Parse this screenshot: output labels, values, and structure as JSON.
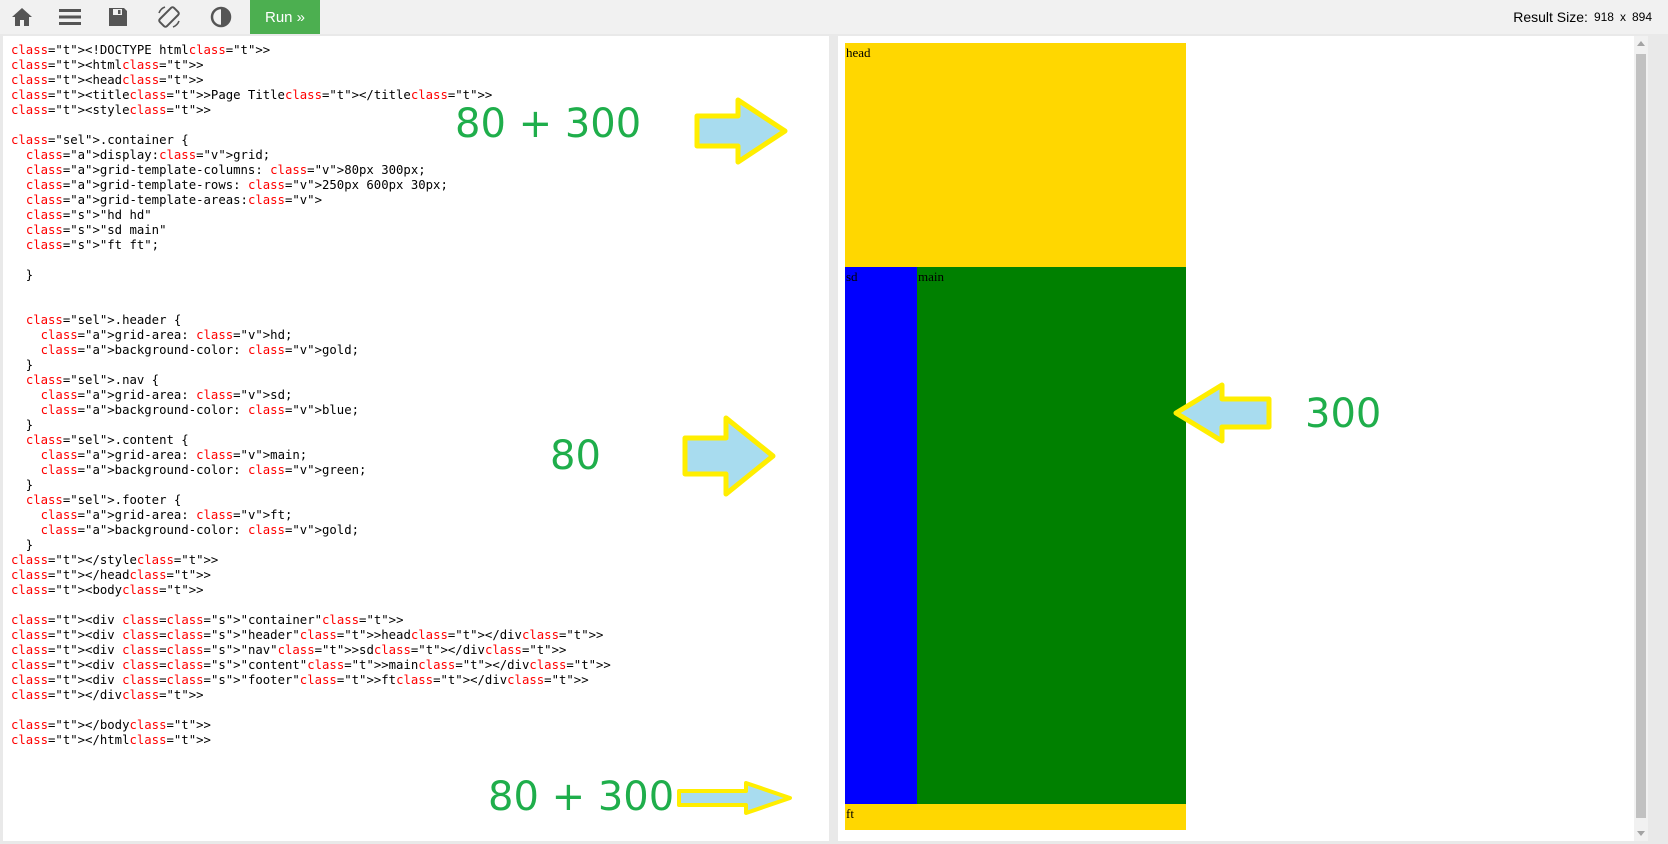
{
  "toolbar": {
    "icons": [
      "home-icon",
      "menu-icon",
      "save-icon",
      "rotate-icon",
      "contrast-icon"
    ],
    "run_label": "Run »",
    "result_size_label": "Result Size:",
    "result_width": "918",
    "result_x": "x",
    "result_height": "894"
  },
  "code": {
    "lines": [
      "<!DOCTYPE html>",
      "<html>",
      "<head>",
      "<title>Page Title</title>",
      "<style>",
      "",
      ".container {",
      "  display:grid;",
      "  grid-template-columns: 80px 300px;",
      "  grid-template-rows: 250px 600px 30px;",
      "  grid-template-areas:",
      "  \"hd hd\"",
      "  \"sd main\"",
      "  \"ft ft\";",
      "",
      "  }",
      "",
      "",
      "  .header {",
      "    grid-area: hd;",
      "    background-color: gold;",
      "  }",
      "  .nav {",
      "    grid-area: sd;",
      "    background-color: blue;",
      "  }",
      "  .content {",
      "    grid-area: main;",
      "    background-color: green;",
      "  }",
      "  .footer {",
      "    grid-area: ft;",
      "    background-color: gold;",
      "  }",
      "</style>",
      "</head>",
      "<body>",
      "",
      "<div class=\"container\">",
      "<div class=\"header\">head</div>",
      "<div class=\"nav\">sd</div>",
      "<div class=\"content\">main</div>",
      "<div class=\"footer\">ft</div>",
      "</div>",
      "",
      "</body>",
      "</html>"
    ]
  },
  "result": {
    "header_text": "head",
    "nav_text": "sd",
    "main_text": "main",
    "footer_text": "ft",
    "colors": {
      "header": "gold",
      "nav": "blue",
      "main": "green",
      "footer": "gold"
    }
  },
  "annotations": {
    "top_note": "80 + 300",
    "middle_note": "80",
    "right_note": "300",
    "bottom_note": "80 + 300",
    "note_color": "#1fae4b",
    "arrow_fill": "#a8dcef",
    "arrow_outline": "#ffee00"
  }
}
